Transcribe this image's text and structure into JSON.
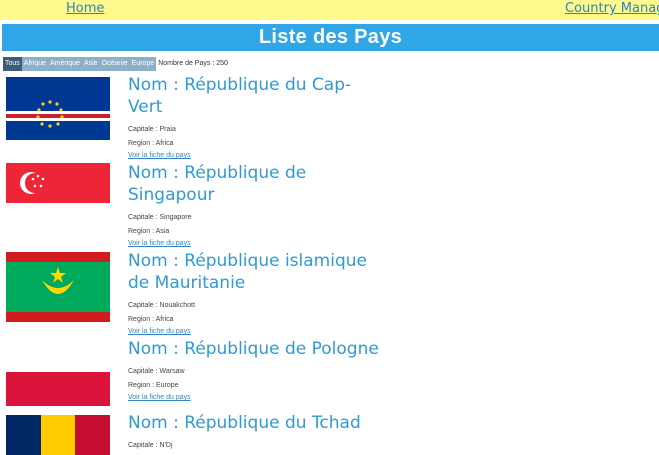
{
  "nav": {
    "home": "Home",
    "manager": "Country Manag"
  },
  "page_title": "Liste des Pays",
  "filters": {
    "tabs": [
      "Tous",
      "Afrique",
      "Amérique",
      "Asie",
      "Océanie",
      "Europe"
    ],
    "active": "Tous",
    "count": "Nombre de Pays : 250"
  },
  "countries": [
    {
      "name": "Nom : République du Cap-Vert",
      "capital": "Capitale : Praia",
      "region": "Region : Africa",
      "link": "Voir la fiche du pays",
      "flag": "cape-verde"
    },
    {
      "name": "Nom : République de Singapour",
      "capital": "Capitale : Singapore",
      "region": "Region : Asia",
      "link": "Voir la fiche du pays",
      "flag": "singapore"
    },
    {
      "name": "Nom : République islamique de Mauritanie",
      "capital": "Capitale : Nouakchott",
      "region": "Region : Africa",
      "link": "Voir la fiche du pays",
      "flag": "mauritania"
    },
    {
      "name": "Nom : République de Pologne",
      "capital": "Capitale : Warsaw",
      "region": "Region : Europe",
      "link": "Voir la fiche du pays",
      "flag": "poland"
    },
    {
      "name": "Nom : République du Tchad",
      "capital": "Capitale : N'Dj",
      "region": "",
      "link": "",
      "flag": "chad"
    }
  ],
  "colors": {
    "nav_bg": "#fdf98a",
    "title_bg": "#30a6e6",
    "link": "#2e86c1",
    "name": "#2e9bd4",
    "tab_bg": "#8db0c9",
    "tab_active": "#3c5d7a"
  }
}
